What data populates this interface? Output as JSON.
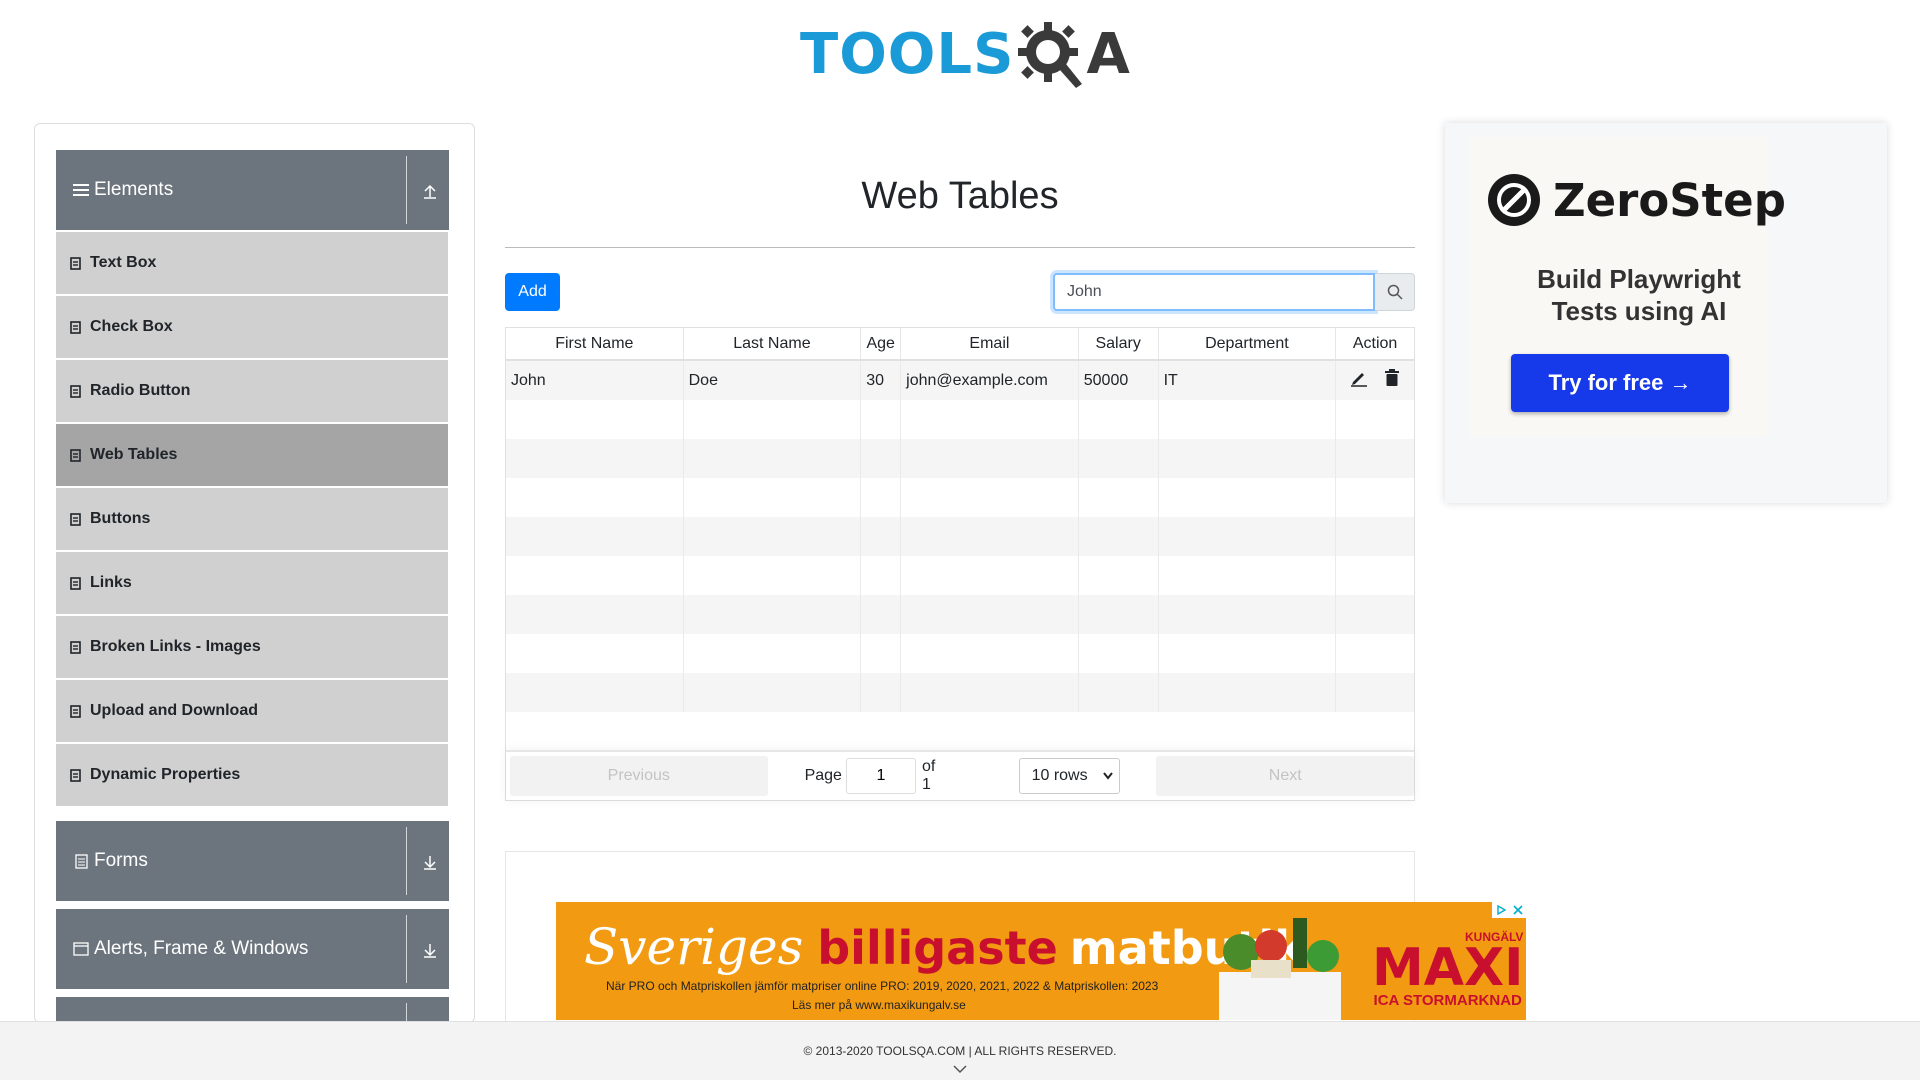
{
  "header": {
    "logo_text_left": "TOOLS",
    "logo_text_right": "A"
  },
  "sidebar": {
    "groups": [
      {
        "label": "Elements",
        "icon": "hamburger-icon",
        "toggle_icon": "collapse-arrow-icon"
      },
      {
        "label": "Forms",
        "icon": "form-icon",
        "toggle_icon": "expand-arrow-icon"
      },
      {
        "label": "Alerts, Frame & Windows",
        "icon": "window-icon",
        "toggle_icon": "expand-arrow-icon"
      }
    ],
    "items": [
      {
        "label": "Text Box"
      },
      {
        "label": "Check Box"
      },
      {
        "label": "Radio Button"
      },
      {
        "label": "Web Tables",
        "active": true
      },
      {
        "label": "Buttons"
      },
      {
        "label": "Links"
      },
      {
        "label": "Broken Links - Images"
      },
      {
        "label": "Upload and Download"
      },
      {
        "label": "Dynamic Properties"
      }
    ]
  },
  "main": {
    "title": "Web Tables",
    "add_label": "Add",
    "search": {
      "value": "John",
      "icon": "search-icon"
    },
    "table": {
      "headers": [
        "First Name",
        "Last Name",
        "Age",
        "Email",
        "Salary",
        "Department",
        "Action"
      ],
      "rows": [
        [
          "John",
          "Doe",
          "30",
          "john@example.com",
          "50000",
          "IT"
        ]
      ],
      "empty_rows": 9
    },
    "pagination": {
      "previous": "Previous",
      "page_label": "Page",
      "page_value": "1",
      "of_label": "of 1",
      "rows_select": "10 rows",
      "next": "Next"
    }
  },
  "right_ad": {
    "brand": "ZeroStep",
    "tagline_line1": "Build Playwright",
    "tagline_line2": "Tests using AI",
    "cta": "Try for free →"
  },
  "bottom_ad": {
    "headline_script": "Sveriges",
    "headline_red": "billigaste",
    "headline_white": "matbutik",
    "sub1": "När PRO och Matpriskollen jämför matpriser online PRO: 2019, 2020, 2021, 2022 & Matpriskollen: 2023",
    "sub2": "Läs mer på www.maxikungalv.se",
    "brand_location": "KUNGÄLV",
    "brand": "MAXI",
    "brand_sub": "ICA STORMARKNAD"
  },
  "footer": {
    "text": "© 2013-2020 TOOLSQA.COM | ALL RIGHTS RESERVED."
  },
  "colors": {
    "primary": "#007bff",
    "sidebar_header": "#6c757d",
    "sidebar_item": "#d0d0d0",
    "sidebar_active": "#a5a5a5",
    "logo_blue": "#1a9ad6",
    "zerostep_blue": "#1639ea",
    "banner_orange": "#f29a12",
    "banner_red": "#c8102e"
  }
}
